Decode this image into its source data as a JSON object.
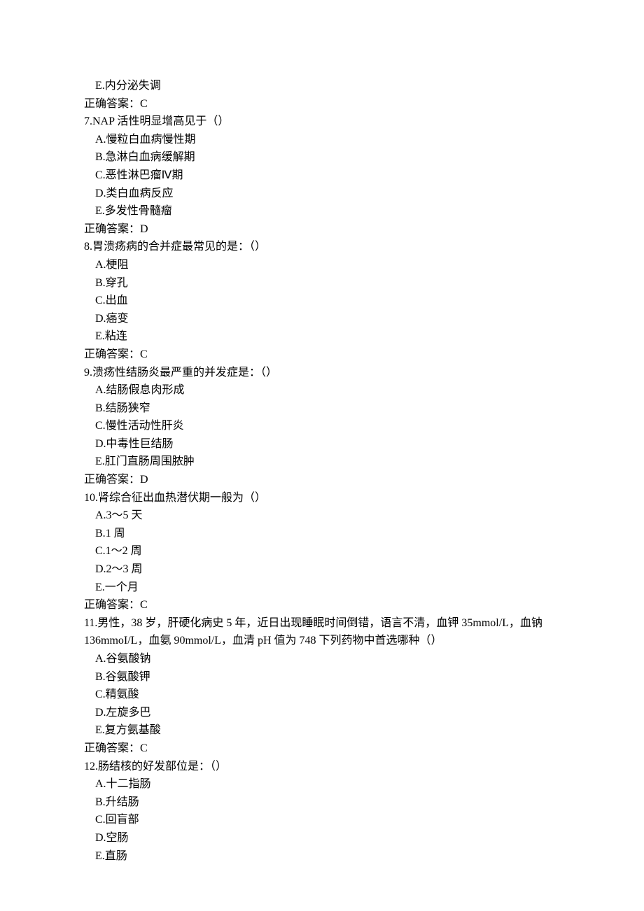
{
  "lines": [
    {
      "cls": "opt",
      "text": "E.内分泌失调"
    },
    {
      "cls": "ans",
      "text": "正确答案：C"
    },
    {
      "cls": "",
      "text": "7.NAP 活性明显增高见于（）"
    },
    {
      "cls": "opt",
      "text": "A.慢粒白血病慢性期"
    },
    {
      "cls": "opt",
      "text": "B.急淋白血病缓解期"
    },
    {
      "cls": "opt",
      "text": "C.恶性淋巴瘤Ⅳ期"
    },
    {
      "cls": "opt",
      "text": "D.类白血病反应"
    },
    {
      "cls": "opt",
      "text": "E.多发性骨髓瘤"
    },
    {
      "cls": "ans",
      "text": "正确答案：D"
    },
    {
      "cls": "",
      "text": "8.胃溃疡病的合并症最常见的是：（）"
    },
    {
      "cls": "opt",
      "text": "A.梗阻"
    },
    {
      "cls": "opt",
      "text": "B.穿孔"
    },
    {
      "cls": "opt",
      "text": "C.出血"
    },
    {
      "cls": "opt",
      "text": "D.癌变"
    },
    {
      "cls": "opt",
      "text": "E.粘连"
    },
    {
      "cls": "ans",
      "text": "正确答案：C"
    },
    {
      "cls": "",
      "text": "9.溃疡性结肠炎最严重的并发症是：（）"
    },
    {
      "cls": "opt",
      "text": "A.结肠假息肉形成"
    },
    {
      "cls": "opt",
      "text": "B.结肠狭窄"
    },
    {
      "cls": "opt",
      "text": "C.慢性活动性肝炎"
    },
    {
      "cls": "opt",
      "text": "D.中毒性巨结肠"
    },
    {
      "cls": "opt",
      "text": "E.肛门直肠周围脓肿"
    },
    {
      "cls": "ans",
      "text": "正确答案：D"
    },
    {
      "cls": "",
      "text": "10.肾综合征出血热潜伏期一般为（）"
    },
    {
      "cls": "opt",
      "text": "A.3～5 天"
    },
    {
      "cls": "opt",
      "text": "B.1 周"
    },
    {
      "cls": "opt",
      "text": "C.1～2 周"
    },
    {
      "cls": "opt",
      "text": "D.2～3 周"
    },
    {
      "cls": "opt",
      "text": "E.一个月"
    },
    {
      "cls": "ans",
      "text": "正确答案：C"
    },
    {
      "cls": "",
      "text": "11.男性，38 岁，肝硬化病史 5 年，近日出现睡眠时间倒错，语言不清，血钾 35mmol/L，血钠 136mmoI/L，血氨 90mmol/L，血清 pH 值为 748 下列药物中首选哪种（）"
    },
    {
      "cls": "opt",
      "text": "A.谷氨酸钠"
    },
    {
      "cls": "opt",
      "text": "B.谷氨酸钾"
    },
    {
      "cls": "opt",
      "text": "C.精氨酸"
    },
    {
      "cls": "opt",
      "text": "D.左旋多巴"
    },
    {
      "cls": "opt",
      "text": "E.复方氨基酸"
    },
    {
      "cls": "ans",
      "text": "正确答案：C"
    },
    {
      "cls": "",
      "text": "12.肠结核的好发部位是：（）"
    },
    {
      "cls": "opt",
      "text": "A.十二指肠"
    },
    {
      "cls": "opt",
      "text": "B.升结肠"
    },
    {
      "cls": "opt",
      "text": "C.回盲部"
    },
    {
      "cls": "opt",
      "text": "D.空肠"
    },
    {
      "cls": "opt",
      "text": "E.直肠"
    }
  ]
}
